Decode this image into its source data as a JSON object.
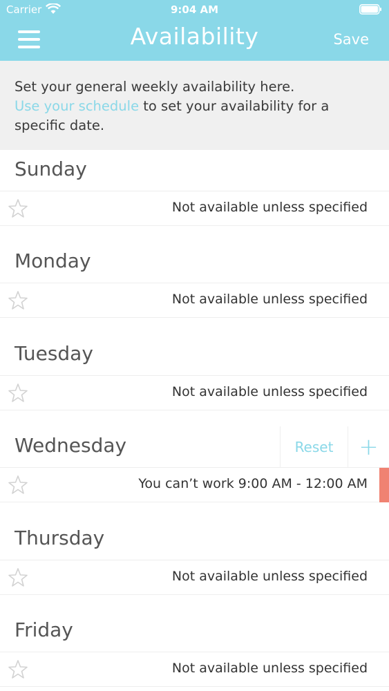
{
  "status_bar": {
    "carrier": "Carrier",
    "time": "9:04 AM"
  },
  "nav": {
    "title": "Availability",
    "save_label": "Save"
  },
  "intro": {
    "text_before": "Set your general weekly availability here.",
    "link_text": "Use your schedule",
    "text_after": "to set your availability for a specific date."
  },
  "colors": {
    "accent": "#8ad8e8",
    "alert": "#f08272",
    "intro_bg": "#f0f0f0"
  },
  "days": [
    {
      "name": "Sunday",
      "status": "Not available unless specified"
    },
    {
      "name": "Monday",
      "status": "Not available unless specified"
    },
    {
      "name": "Tuesday",
      "status": "Not available unless specified"
    },
    {
      "name": "Wednesday",
      "status": "You can’t work 9:00 AM - 12:00 AM",
      "reset_label": "Reset",
      "add_label": "+"
    },
    {
      "name": "Thursday",
      "status": "Not available unless specified"
    },
    {
      "name": "Friday",
      "status": "Not available unless specified"
    }
  ]
}
